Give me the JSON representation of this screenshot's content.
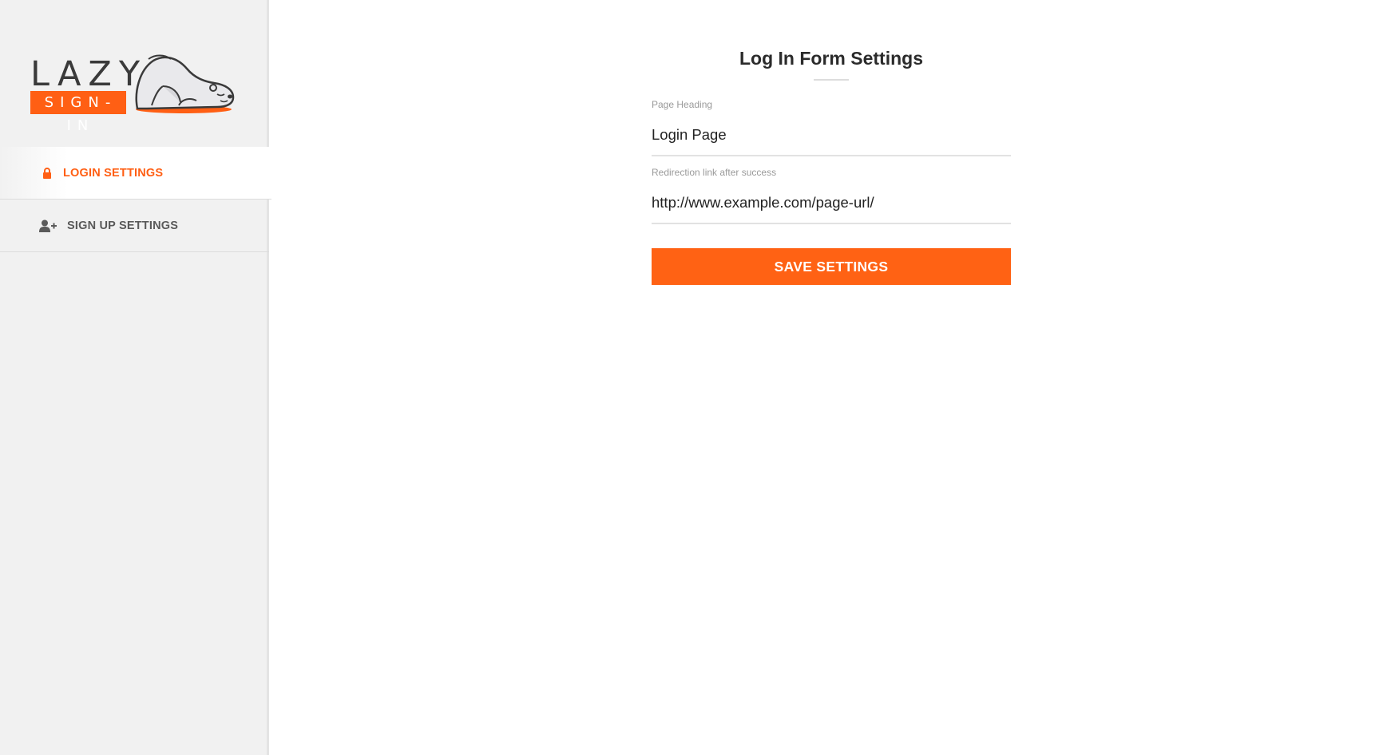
{
  "brand": {
    "word": "LAZY",
    "sub": "SIGN-IN",
    "accent_color": "#ff5f14"
  },
  "sidebar": {
    "items": [
      {
        "label": "LOGIN SETTINGS",
        "icon": "lock-icon",
        "active": true
      },
      {
        "label": "SIGN UP SETTINGS",
        "icon": "user-plus-icon",
        "active": false
      }
    ]
  },
  "form": {
    "title": "Log In Form Settings",
    "fields": [
      {
        "label": "Page Heading",
        "value": "Login Page"
      },
      {
        "label": "Redirection link after success",
        "value": "http://www.example.com/page-url/"
      }
    ],
    "save_label": "SAVE SETTINGS"
  }
}
